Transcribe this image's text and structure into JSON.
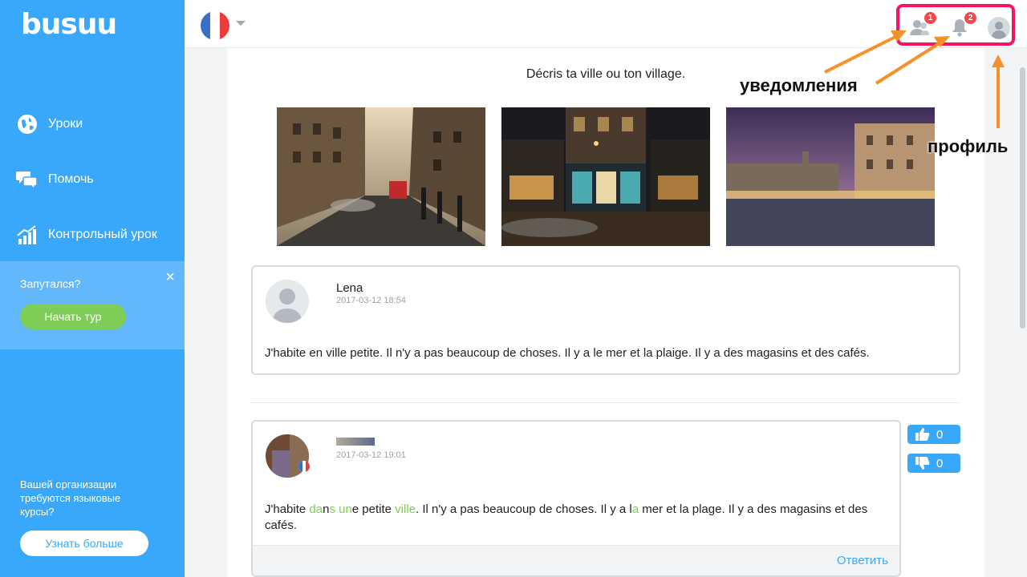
{
  "app": {
    "logo": "busuu"
  },
  "sidebar": {
    "items": [
      {
        "label": "Уроки",
        "icon": "globe-icon"
      },
      {
        "label": "Помочь",
        "icon": "chat-icon"
      },
      {
        "label": "Контрольный урок",
        "icon": "chart-icon"
      }
    ],
    "tour": {
      "question": "Запутался?",
      "close": "×",
      "button": "Начать тур"
    },
    "org": {
      "text": "Вашей организации требуются языковые курсы?",
      "button": "Узнать больше"
    }
  },
  "topbar": {
    "language_flag": "france-flag-icon",
    "friends_badge": "1",
    "notifications_badge": "2"
  },
  "annotations": {
    "notifications": "уведомления",
    "profile": "профиль"
  },
  "exercise": {
    "title": "Décris ta ville ou ton village.",
    "photos": [
      "city-street-photo",
      "night-shops-photo",
      "town-square-photo"
    ]
  },
  "post": {
    "author": "Lena",
    "date": "2017-03-12 18:54",
    "text": "J'habite en ville petite. Il n'y a pas beaucoup de choses. Il y a le mer et la plaige. Il y a des magasins et des cafés."
  },
  "correction": {
    "date": "2017-03-12 19:01",
    "segments": [
      {
        "t": "J'habite ",
        "hl": false
      },
      {
        "t": "da",
        "hl": true
      },
      {
        "t": "n",
        "hl": false
      },
      {
        "t": "s",
        "hl": true
      },
      {
        "t": " ",
        "hl": false
      },
      {
        "t": "un",
        "hl": true
      },
      {
        "t": "e petite ",
        "hl": false
      },
      {
        "t": "ville",
        "hl": true
      },
      {
        "t": ". Il n'y a pas beaucoup de choses. Il y a l",
        "hl": false
      },
      {
        "t": "a",
        "hl": true
      },
      {
        "t": " mer et la plage. Il y a des magasins et des cafés.",
        "hl": false
      }
    ],
    "reply": "Ответить",
    "upvotes": "0",
    "downvotes": "0"
  },
  "colors": {
    "sidebar": "#39a7fa",
    "accent_green": "#7ecd57",
    "highlight_box": "#f7135e",
    "arrow": "#f5902a"
  }
}
